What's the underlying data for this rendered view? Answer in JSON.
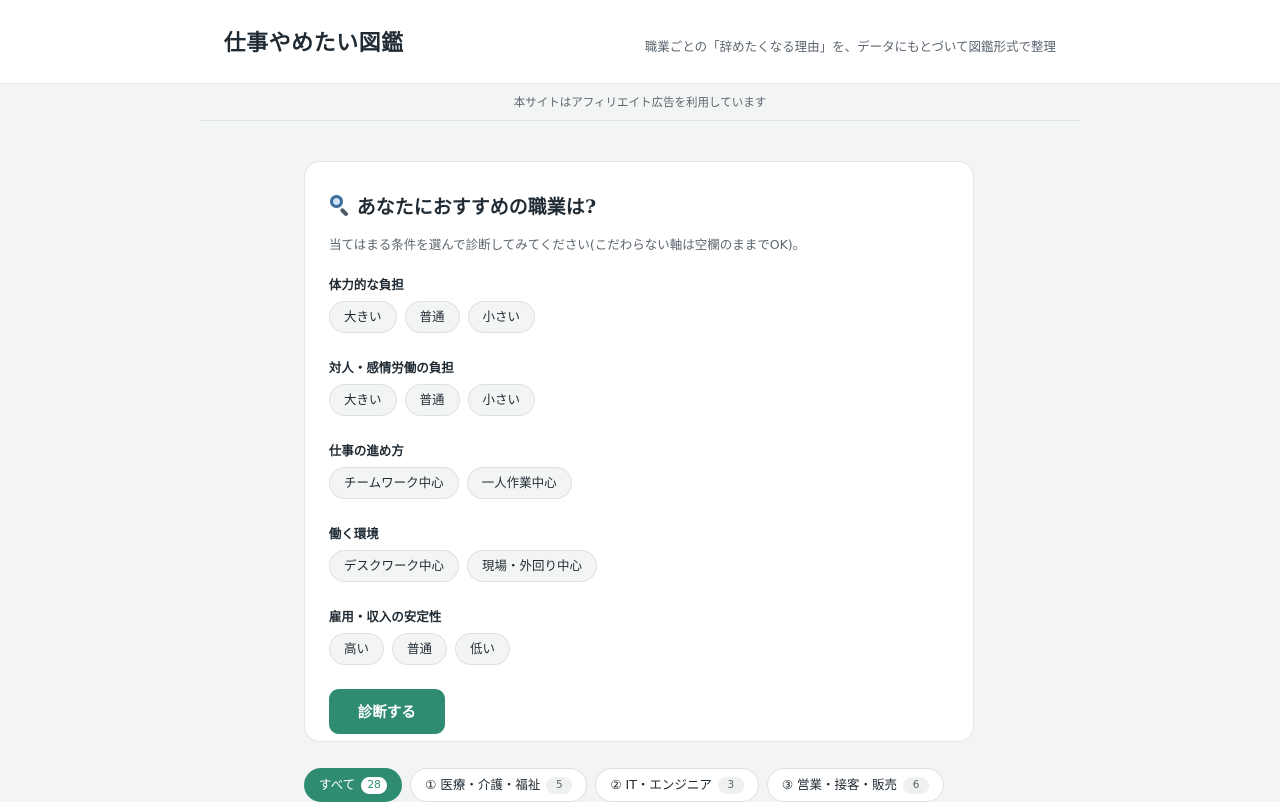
{
  "header": {
    "site_title": "仕事やめたい図鑑",
    "tagline": "職業ごとの「辞めたくなる理由」を、データにもとづいて図鑑形式で整理"
  },
  "notice": "本サイトはアフィリエイト広告を利用しています",
  "diagnosis": {
    "title": "あなたにおすすめの職業は?",
    "description": "当てはまる条件を選んで診断してみてください(こだわらない軸は空欄のままでOK)。",
    "groups": [
      {
        "label": "体力的な負担",
        "options": [
          "大きい",
          "普通",
          "小さい"
        ]
      },
      {
        "label": "対人・感情労働の負担",
        "options": [
          "大きい",
          "普通",
          "小さい"
        ]
      },
      {
        "label": "仕事の進め方",
        "options": [
          "チームワーク中心",
          "一人作業中心"
        ]
      },
      {
        "label": "働く環境",
        "options": [
          "デスクワーク中心",
          "現場・外回り中心"
        ]
      },
      {
        "label": "雇用・収入の安定性",
        "options": [
          "高い",
          "普通",
          "低い"
        ]
      }
    ],
    "submit_label": "診断する"
  },
  "filters": [
    {
      "label": "すべて",
      "count": "28",
      "active": true
    },
    {
      "label": "① 医療・介護・福祉",
      "count": "5",
      "active": false
    },
    {
      "label": "② IT・エンジニア",
      "count": "3",
      "active": false
    },
    {
      "label": "③ 営業・接客・販売",
      "count": "6",
      "active": false
    }
  ],
  "colors": {
    "accent": "#2f8c73",
    "background": "#f3f5f4",
    "text": "#1f2a33"
  }
}
